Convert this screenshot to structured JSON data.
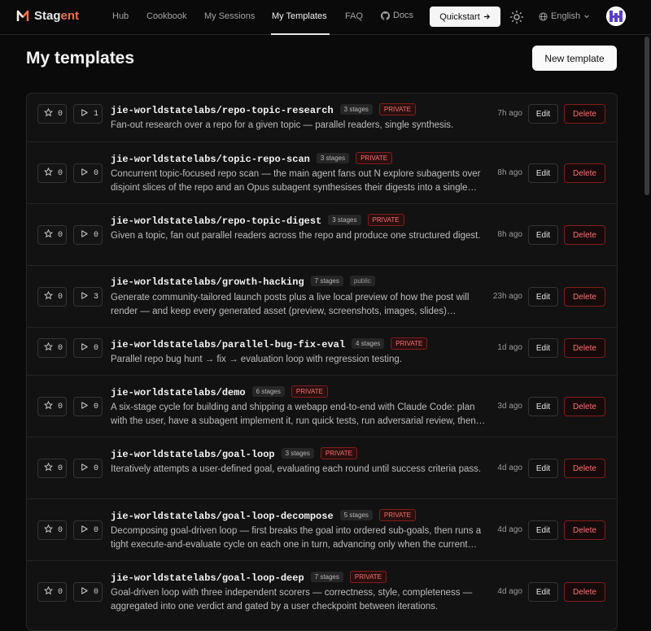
{
  "brand": {
    "prefix": "Stag",
    "suffix": "ent",
    "accent": "#f0714a"
  },
  "nav": {
    "hub": "Hub",
    "cookbook": "Cookbook",
    "sessions": "My Sessions",
    "templates": "My Templates",
    "faq": "FAQ",
    "docs": "Docs",
    "quickstart": "Quickstart",
    "language": "English"
  },
  "header": {
    "title": "My templates",
    "new_button": "New template"
  },
  "actions": {
    "edit": "Edit",
    "delete": "Delete"
  },
  "templates": [
    {
      "name": "jie-worldstatelabs/repo-topic-research",
      "stages": "3 stages",
      "visibility": "PRIVATE",
      "stars": "0",
      "runs": "1",
      "ago": "7h ago",
      "desc": "Fan-out research over a repo for a given topic — parallel readers, single synthesis."
    },
    {
      "name": "jie-worldstatelabs/topic-repo-scan",
      "stages": "3 stages",
      "visibility": "PRIVATE",
      "stars": "0",
      "runs": "0",
      "ago": "8h ago",
      "desc": "Concurrent topic-focused repo scan — the main agent fans out N explore subagents over disjoint slices of the repo and an Opus subagent synthesises their digests into a single report."
    },
    {
      "name": "jie-worldstatelabs/repo-topic-digest",
      "stages": "3 stages",
      "visibility": "PRIVATE",
      "stars": "0",
      "runs": "0",
      "ago": "8h ago",
      "desc": "Given a topic, fan out parallel readers across the repo and produce one structured digest."
    },
    {
      "name": "jie-worldstatelabs/growth-hacking",
      "stages": "7 stages",
      "visibility": "public",
      "stars": "0",
      "runs": "3",
      "ago": "23h ago",
      "desc": "Generate community-tailored launch posts plus a live local preview of how the post will render — and keep every generated asset (preview, screenshots, images, slides) organized in one place."
    },
    {
      "name": "jie-worldstatelabs/parallel-bug-fix-eval",
      "stages": "4 stages",
      "visibility": "PRIVATE",
      "stars": "0",
      "runs": "0",
      "ago": "1d ago",
      "desc": "Parallel repo bug hunt → fix → evaluation loop with regression testing."
    },
    {
      "name": "jie-worldstatelabs/demo",
      "stages": "6 stages",
      "visibility": "PRIVATE",
      "stars": "0",
      "runs": "0",
      "ago": "3d ago",
      "desc": "A six-stage cycle for building and shipping a webapp end-to-end with Claude Code: plan with the user, have a subagent implement it, run quick tests, run adversarial review, then ship."
    },
    {
      "name": "jie-worldstatelabs/goal-loop",
      "stages": "3 stages",
      "visibility": "PRIVATE",
      "stars": "0",
      "runs": "0",
      "ago": "4d ago",
      "desc": "Iteratively attempts a user-defined goal, evaluating each round until success criteria pass."
    },
    {
      "name": "jie-worldstatelabs/goal-loop-decompose",
      "stages": "5 stages",
      "visibility": "PRIVATE",
      "stars": "0",
      "runs": "0",
      "ago": "4d ago",
      "desc": "Decomposing goal-driven loop — first breaks the goal into ordered sub-goals, then runs a tight execute-and-evaluate cycle on each one in turn, advancing only when the current sub-goal passes."
    },
    {
      "name": "jie-worldstatelabs/goal-loop-deep",
      "stages": "7 stages",
      "visibility": "PRIVATE",
      "stars": "0",
      "runs": "0",
      "ago": "4d ago",
      "desc": "Goal-driven loop with three independent scorers — correctness, style, completeness — aggregated into one verdict and gated by a user checkpoint between iterations."
    }
  ]
}
